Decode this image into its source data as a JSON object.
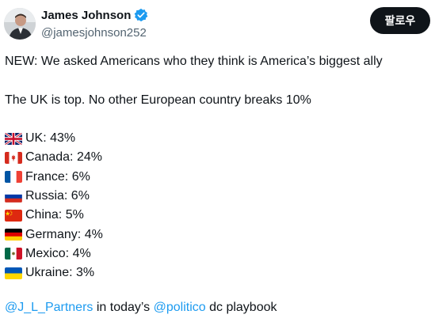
{
  "author": {
    "name": "James Johnson",
    "handle": "@jamesjohnson252",
    "follow_label": "팔로우"
  },
  "post": {
    "headline": "NEW: We asked Americans who they think is America’s biggest ally",
    "subline": "The UK is top. No other European country breaks 10%",
    "items": [
      {
        "label": "UK: 43%",
        "flag": "uk-flag-icon"
      },
      {
        "label": "Canada: 24%",
        "flag": "canada-flag-icon"
      },
      {
        "label": "France: 6%",
        "flag": "france-flag-icon"
      },
      {
        "label": "Russia: 6%",
        "flag": "russia-flag-icon"
      },
      {
        "label": "China: 5%",
        "flag": "china-flag-icon"
      },
      {
        "label": "Germany: 4%",
        "flag": "germany-flag-icon"
      },
      {
        "label": "Mexico: 4%",
        "flag": "mexico-flag-icon"
      },
      {
        "label": "Ukraine: 3%",
        "flag": "ukraine-flag-icon"
      }
    ],
    "footer": {
      "mention1": "@J_L_Partners",
      "mid_text": " in today’s ",
      "mention2": "@politico",
      "end_text": " dc playbook"
    }
  },
  "colors": {
    "link": "#1d9bf0",
    "verified": "#1d9bf0",
    "follow_bg": "#0f1419",
    "secondary_text": "#536471"
  }
}
